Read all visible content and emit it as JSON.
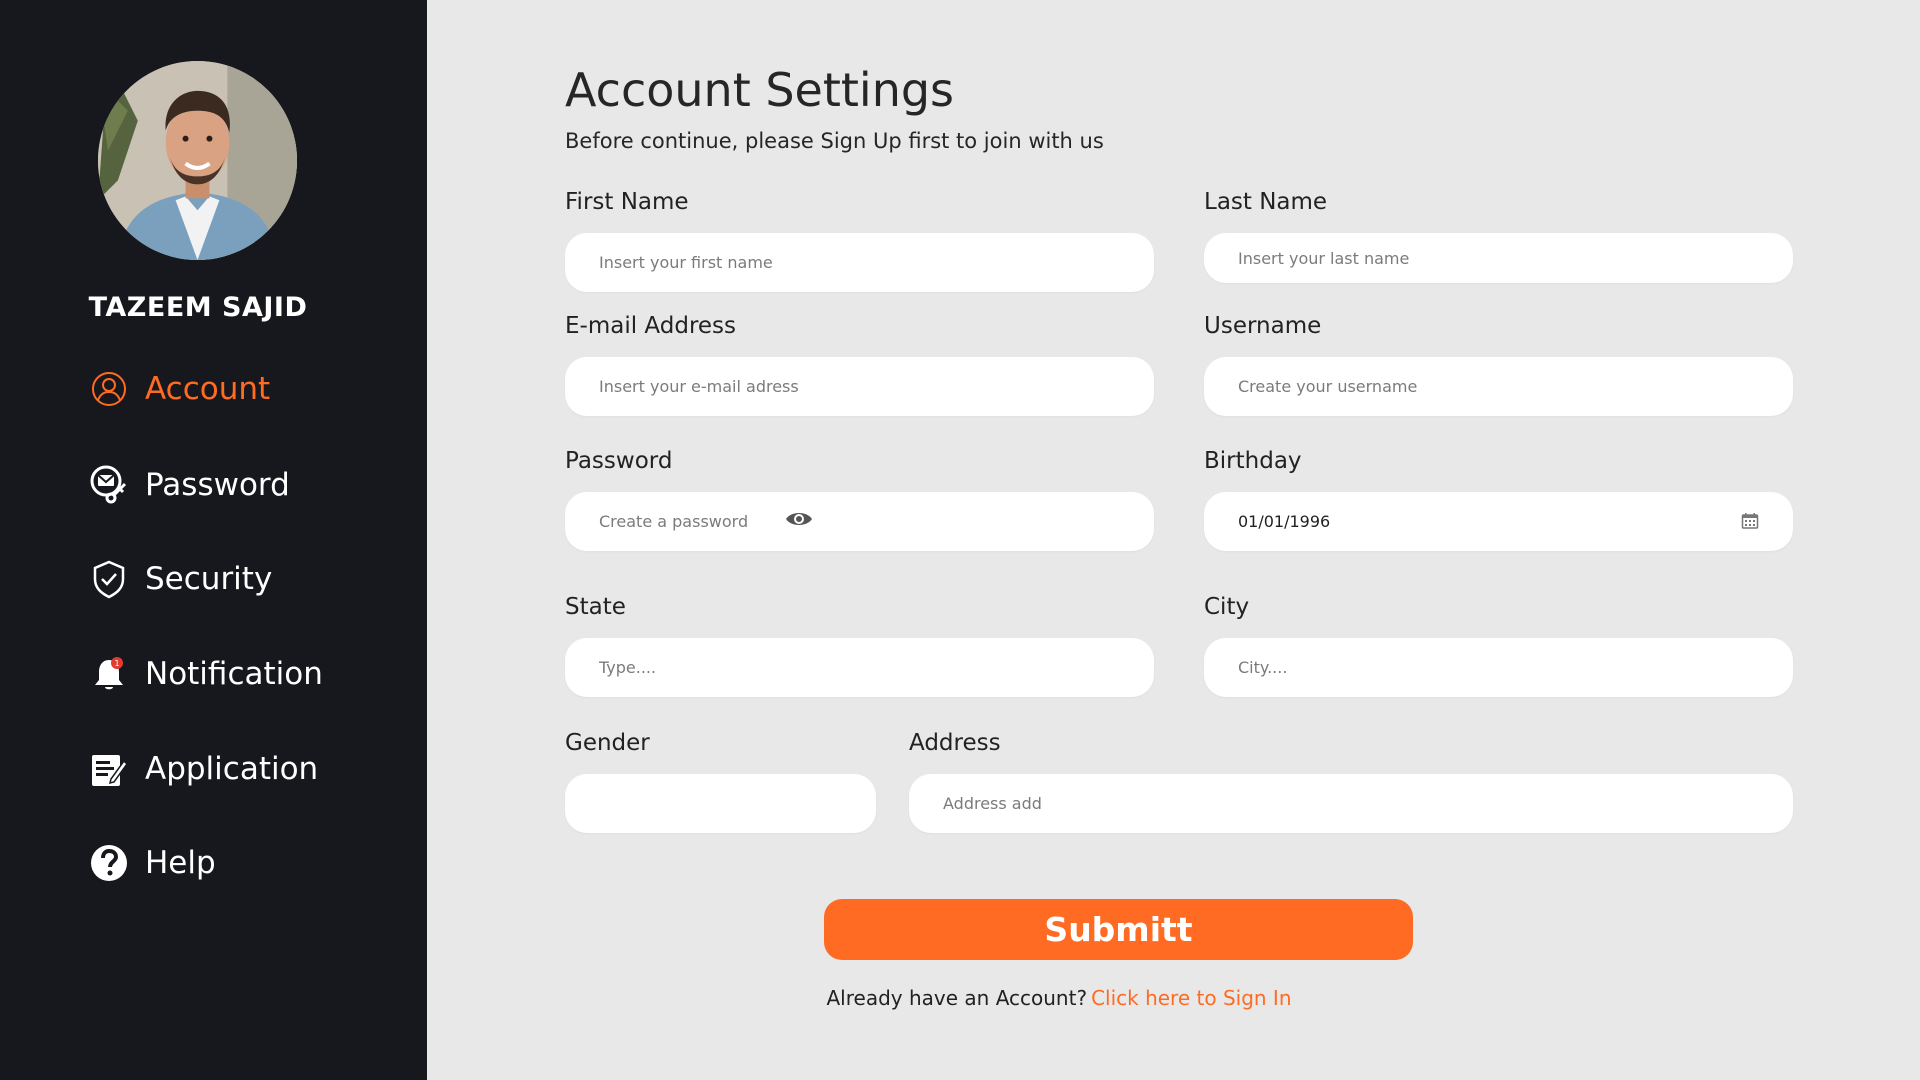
{
  "sidebar": {
    "user_name": "TAZEEM SAJID",
    "items": [
      {
        "label": "Account",
        "icon": "user-circle-icon",
        "active": true
      },
      {
        "label": "Password",
        "icon": "mail-key-icon",
        "active": false
      },
      {
        "label": "Security",
        "icon": "shield-check-icon",
        "active": false
      },
      {
        "label": "Notification",
        "icon": "bell-icon",
        "active": false
      },
      {
        "label": "Application",
        "icon": "document-edit-icon",
        "active": false
      },
      {
        "label": "Help",
        "icon": "help-circle-icon",
        "active": false
      }
    ]
  },
  "main": {
    "title": "Account Settings",
    "subtitle": "Before continue, please Sign Up first to join with us",
    "fields": {
      "first_name": {
        "label": "First Name",
        "placeholder": "Insert your first name",
        "value": ""
      },
      "last_name": {
        "label": "Last Name",
        "placeholder": "Insert your last name",
        "value": ""
      },
      "email": {
        "label": "E-mail Address",
        "placeholder": "Insert your e-mail adress",
        "value": ""
      },
      "username": {
        "label": "Username",
        "placeholder": "Create your username",
        "value": ""
      },
      "password": {
        "label": "Password",
        "placeholder": "Create a password",
        "value": ""
      },
      "birthday": {
        "label": "Birthday",
        "placeholder": "",
        "value": "01/01/1996"
      },
      "state": {
        "label": "State",
        "placeholder": "Type....",
        "value": ""
      },
      "city": {
        "label": "City",
        "placeholder": "City....",
        "value": ""
      },
      "gender": {
        "label": "Gender",
        "placeholder": "",
        "value": ""
      },
      "address": {
        "label": "Address",
        "placeholder": "Address add",
        "value": ""
      }
    },
    "submit_label": "Submitt",
    "signin_prompt": "Already have an Account?",
    "signin_link": "Click here to Sign In"
  },
  "colors": {
    "accent": "#fe6b23",
    "sidebar_bg": "#17181d",
    "page_bg": "#e8e8e8",
    "field_bg": "#ffffff"
  }
}
